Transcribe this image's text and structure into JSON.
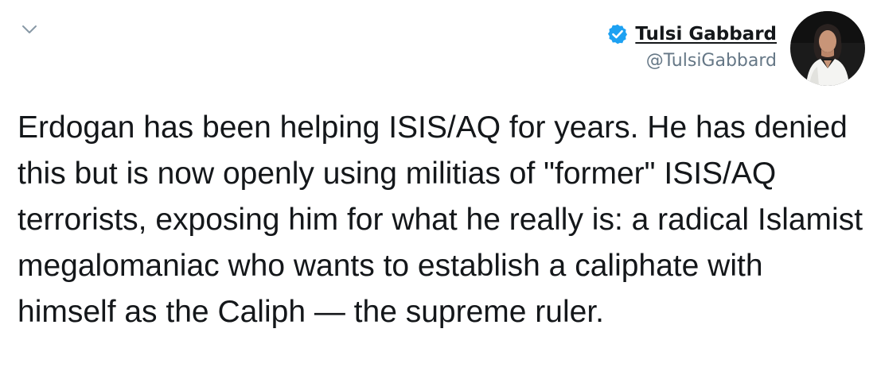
{
  "tweet": {
    "author": {
      "display_name": "Tulsi Gabbard",
      "handle": "@TulsiGabbard",
      "verified": true
    },
    "text": "Erdogan has been helping ISIS/AQ for years. He has denied this but is now openly using militias of \"former\" ISIS/AQ terrorists, exposing him for what he really is: a radical Islamist megalomaniac who wants to establish a caliphate with himself as the Caliph — the supreme ruler."
  },
  "icons": {
    "menu": "chevron-down-icon",
    "verified": "verified-badge-icon"
  },
  "colors": {
    "verified_blue": "#1da1f2",
    "text": "#14171a",
    "secondary_text": "#657786",
    "background": "#ffffff"
  }
}
